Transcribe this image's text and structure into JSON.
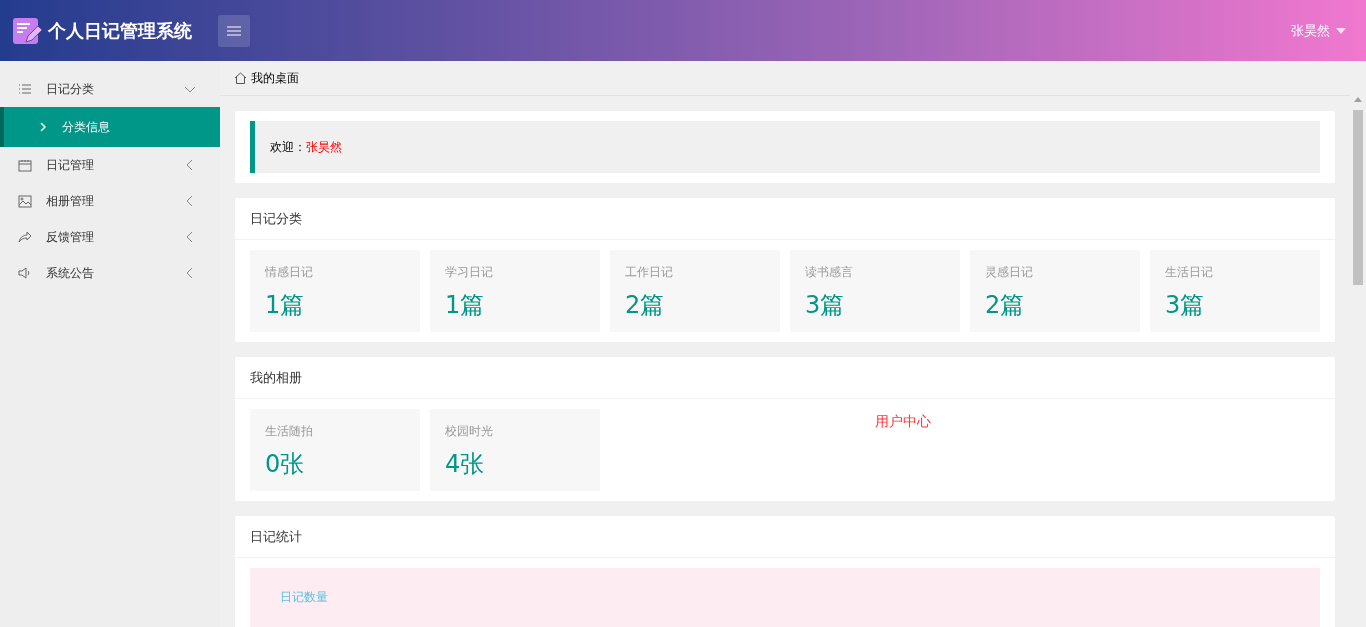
{
  "header": {
    "title": "个人日记管理系统",
    "user": "张昊然"
  },
  "sidebar": {
    "items": [
      {
        "label": "日记分类",
        "expanded": true,
        "children": [
          {
            "label": "分类信息",
            "selected": true
          }
        ]
      },
      {
        "label": "日记管理",
        "expanded": false
      },
      {
        "label": "相册管理",
        "expanded": false
      },
      {
        "label": "反馈管理",
        "expanded": false
      },
      {
        "label": "系统公告",
        "expanded": false
      }
    ]
  },
  "breadcrumb": "我的桌面",
  "welcome": {
    "label": "欢迎：",
    "name": "张昊然"
  },
  "diary_categories": {
    "title": "日记分类",
    "items": [
      {
        "label": "情感日记",
        "value": "1篇"
      },
      {
        "label": "学习日记",
        "value": "1篇"
      },
      {
        "label": "工作日记",
        "value": "2篇"
      },
      {
        "label": "读书感言",
        "value": "3篇"
      },
      {
        "label": "灵感日记",
        "value": "2篇"
      },
      {
        "label": "生活日记",
        "value": "3篇"
      }
    ]
  },
  "albums": {
    "title": "我的相册",
    "items": [
      {
        "label": "生活随拍",
        "value": "0张"
      },
      {
        "label": "校园时光",
        "value": "4张"
      }
    ],
    "note": "用户中心"
  },
  "statistics": {
    "title": "日记统计",
    "items": [
      {
        "label": "日记数量"
      }
    ]
  }
}
